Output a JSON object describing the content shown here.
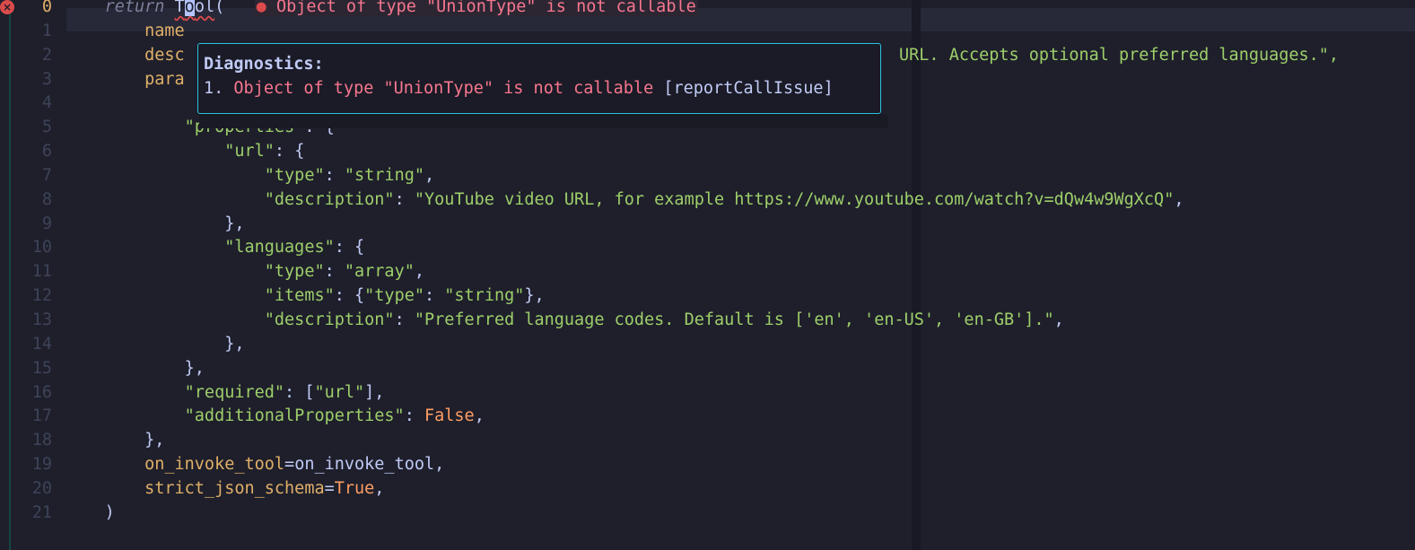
{
  "editor": {
    "lines": [
      {
        "n": "0",
        "active": true,
        "indent": "    ",
        "segments": [
          {
            "t": "return",
            "c": "kw"
          },
          {
            "t": " ",
            "c": "punc"
          },
          {
            "t": "T",
            "c": "fn squig"
          },
          {
            "t": "o",
            "c": "cursor squig"
          },
          {
            "t": "ol",
            "c": "fn squig"
          },
          {
            "t": "(",
            "c": "punc"
          }
        ]
      },
      {
        "n": "1",
        "indent": "        ",
        "segments": [
          {
            "t": "name",
            "c": "param"
          }
        ]
      },
      {
        "n": "2",
        "indent": "        ",
        "segments": [
          {
            "t": "desc",
            "c": "param"
          }
        ]
      },
      {
        "n": "3",
        "indent": "        ",
        "segments": [
          {
            "t": "para",
            "c": "param"
          }
        ]
      },
      {
        "n": "4",
        "indent": "",
        "segments": []
      },
      {
        "n": "5",
        "indent": "            ",
        "segments": [
          {
            "t": "\"properties\"",
            "c": "key"
          },
          {
            "t": ": {",
            "c": "punc"
          }
        ]
      },
      {
        "n": "6",
        "indent": "                ",
        "segments": [
          {
            "t": "\"url\"",
            "c": "key"
          },
          {
            "t": ": {",
            "c": "punc"
          }
        ]
      },
      {
        "n": "7",
        "indent": "                    ",
        "segments": [
          {
            "t": "\"type\"",
            "c": "key"
          },
          {
            "t": ": ",
            "c": "punc"
          },
          {
            "t": "\"string\"",
            "c": "str"
          },
          {
            "t": ",",
            "c": "punc"
          }
        ]
      },
      {
        "n": "8",
        "indent": "                    ",
        "segments": [
          {
            "t": "\"description\"",
            "c": "key"
          },
          {
            "t": ": ",
            "c": "punc"
          },
          {
            "t": "\"YouTube video URL, for example https://www.youtube.com/watch?v=dQw4w9WgXcQ\"",
            "c": "str"
          },
          {
            "t": ",",
            "c": "punc"
          }
        ]
      },
      {
        "n": "9",
        "indent": "                ",
        "segments": [
          {
            "t": "},",
            "c": "punc"
          }
        ]
      },
      {
        "n": "10",
        "indent": "                ",
        "segments": [
          {
            "t": "\"languages\"",
            "c": "key"
          },
          {
            "t": ": {",
            "c": "punc"
          }
        ]
      },
      {
        "n": "11",
        "indent": "                    ",
        "segments": [
          {
            "t": "\"type\"",
            "c": "key"
          },
          {
            "t": ": ",
            "c": "punc"
          },
          {
            "t": "\"array\"",
            "c": "str"
          },
          {
            "t": ",",
            "c": "punc"
          }
        ]
      },
      {
        "n": "12",
        "indent": "                    ",
        "segments": [
          {
            "t": "\"items\"",
            "c": "key"
          },
          {
            "t": ": {",
            "c": "punc"
          },
          {
            "t": "\"type\"",
            "c": "key"
          },
          {
            "t": ": ",
            "c": "punc"
          },
          {
            "t": "\"string\"",
            "c": "str"
          },
          {
            "t": "},",
            "c": "punc"
          }
        ]
      },
      {
        "n": "13",
        "indent": "                    ",
        "segments": [
          {
            "t": "\"description\"",
            "c": "key"
          },
          {
            "t": ": ",
            "c": "punc"
          },
          {
            "t": "\"Preferred language codes. Default is ['en', 'en-US', 'en-GB'].\"",
            "c": "str"
          },
          {
            "t": ",",
            "c": "punc"
          }
        ]
      },
      {
        "n": "14",
        "indent": "                ",
        "segments": [
          {
            "t": "},",
            "c": "punc"
          }
        ]
      },
      {
        "n": "15",
        "indent": "            ",
        "segments": [
          {
            "t": "},",
            "c": "punc"
          }
        ]
      },
      {
        "n": "16",
        "indent": "            ",
        "segments": [
          {
            "t": "\"required\"",
            "c": "key"
          },
          {
            "t": ": [",
            "c": "punc"
          },
          {
            "t": "\"url\"",
            "c": "str"
          },
          {
            "t": "],",
            "c": "punc"
          }
        ]
      },
      {
        "n": "17",
        "indent": "            ",
        "segments": [
          {
            "t": "\"additionalProperties\"",
            "c": "key"
          },
          {
            "t": ": ",
            "c": "punc"
          },
          {
            "t": "False",
            "c": "const"
          },
          {
            "t": ",",
            "c": "punc"
          }
        ]
      },
      {
        "n": "18",
        "indent": "        ",
        "segments": [
          {
            "t": "},",
            "c": "punc"
          }
        ]
      },
      {
        "n": "19",
        "indent": "        ",
        "segments": [
          {
            "t": "on_invoke_tool",
            "c": "param"
          },
          {
            "t": "=",
            "c": "punc"
          },
          {
            "t": "on_invoke_tool",
            "c": "val"
          },
          {
            "t": ",",
            "c": "punc"
          }
        ]
      },
      {
        "n": "20",
        "indent": "        ",
        "segments": [
          {
            "t": "strict_json_schema",
            "c": "param"
          },
          {
            "t": "=",
            "c": "punc"
          },
          {
            "t": "True",
            "c": "const"
          },
          {
            "t": ",",
            "c": "punc"
          }
        ]
      },
      {
        "n": "21",
        "indent": "    ",
        "segments": [
          {
            "t": ")",
            "c": "punc"
          }
        ]
      }
    ],
    "line2_tail": "URL. Accepts optional preferred languages.\",",
    "inline_diagnostic": "Object of type \"UnionType\" is not callable",
    "error_icon": "×"
  },
  "tooltip": {
    "title": "Diagnostics:",
    "index": "1.",
    "message": "Object of type \"UnionType\" is not callable",
    "code": "[reportCallIssue]"
  },
  "colors": {
    "background": "#1e1f2b",
    "error": "#db4b4b",
    "string": "#9ece6a",
    "param": "#e0af68",
    "border": "#2ac3de"
  }
}
